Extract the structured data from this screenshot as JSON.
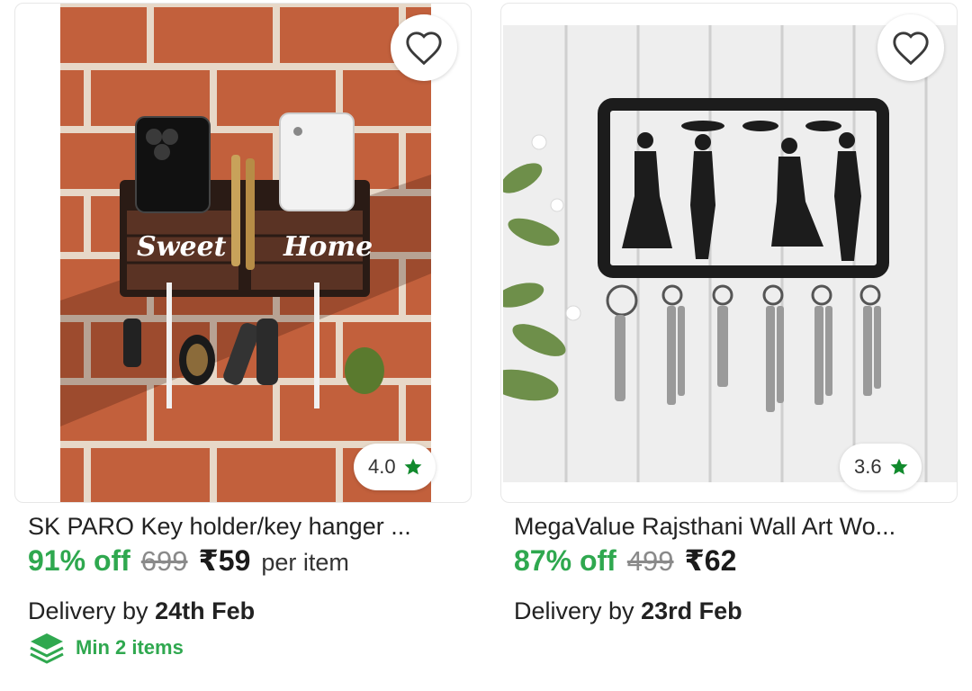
{
  "colors": {
    "discount_green": "#2fa84f",
    "star_green": "#118a2d",
    "mrp_gray": "#8a8a8a"
  },
  "products": [
    {
      "title": "SK PARO Key holder/key hanger ...",
      "rating": "4.0",
      "rating_icon": "star-icon",
      "wishlist_icon": "heart-outline-icon",
      "discount": "91% off",
      "mrp": "699",
      "price": "₹59",
      "per_unit": "per item",
      "delivery_prefix": "Delivery by",
      "delivery_date": "24th Feb",
      "min_items": "Min 2 items",
      "min_items_icon": "stack-layers-icon",
      "image_text_1": "Sweet",
      "image_text_2": "Home"
    },
    {
      "title": "MegaValue Rajsthani Wall Art Wo...",
      "rating": "3.6",
      "rating_icon": "star-icon",
      "wishlist_icon": "heart-outline-icon",
      "discount": "87% off",
      "mrp": "499",
      "price": "₹62",
      "delivery_prefix": "Delivery by",
      "delivery_date": "23rd Feb"
    }
  ]
}
